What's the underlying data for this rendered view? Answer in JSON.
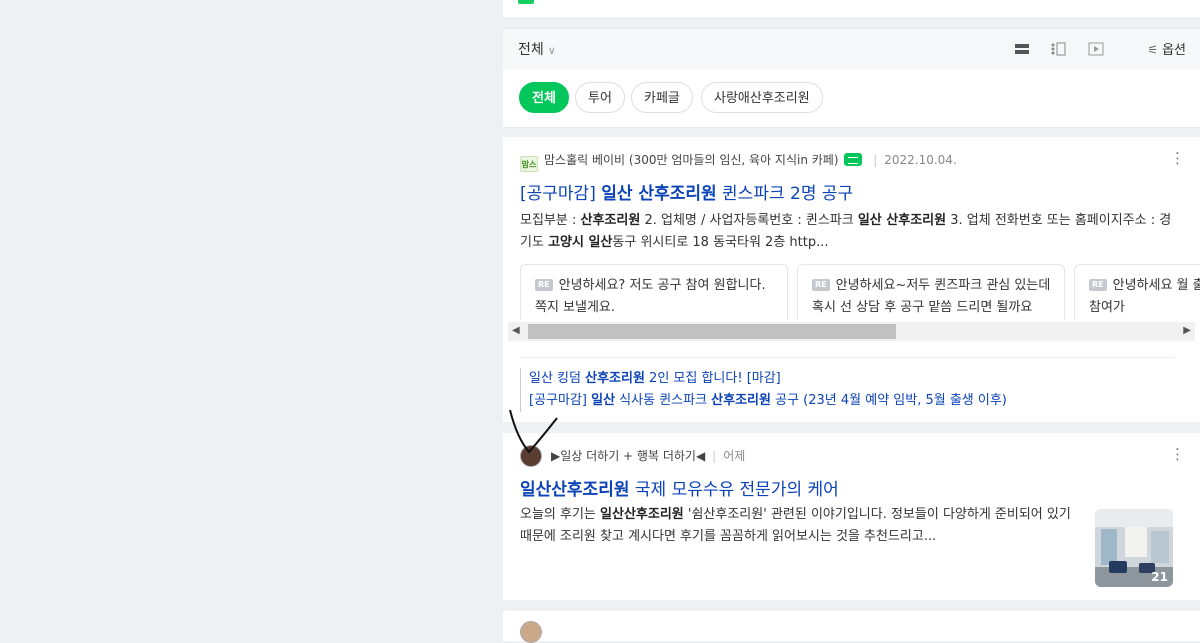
{
  "toolbar": {
    "filter_label": "전체",
    "options_label": "옵션",
    "view_icons": [
      "list-view-icon",
      "compact-view-icon",
      "video-view-icon"
    ]
  },
  "chips": [
    {
      "label": "전체",
      "active": true
    },
    {
      "label": "투어",
      "active": false
    },
    {
      "label": "카페글",
      "active": false
    },
    {
      "label": "사랑애산후조리원",
      "active": false
    }
  ],
  "results": [
    {
      "source": "맘스홀릭 베이비 (300만 엄마들의 임신, 육아 지식in 카페)",
      "logo_text": "맘스",
      "date": "2022.10.04.",
      "title_parts": [
        "[공구마감] ",
        "일산 산후조리원",
        " 퀸스파크 2명 공구"
      ],
      "desc_parts": [
        "모집부분 : ",
        "산후조리원",
        " 2. 업체명 / 사업자등록번호 : 퀸스파크 ",
        "일산 산후조리원",
        " 3. 업체 전화번호 또는 홈페이지주소 : 경기도 ",
        "고양시 일산",
        "동구 위시티로 18 동국타워 2층 http..."
      ],
      "replies": [
        "안녕하세요? 저도 공구 참여 원합니다. 쪽지 보낼게요.",
        "안녕하세요~저두 퀸즈파크 관심 있는데 혹시 선 상담 후 공구 맡씀 드리면 될까요",
        "안녕하세요 월 출산도 참여가"
      ],
      "reply_badge": "RE",
      "related": [
        {
          "parts": [
            "일산 킹덤 ",
            "산후조리원",
            " 2인 모집 합니다! [마감]"
          ]
        },
        {
          "parts": [
            "[공구마감] ",
            "일산",
            " 식사동 퀸스파크 ",
            "산후조리원",
            " 공구 (23년 4월 예약 임박, 5월 출생 이후)"
          ]
        }
      ]
    },
    {
      "source": "▶일상 더하기 + 행복 더하기◀",
      "date": "어제",
      "title_parts": [
        "일산산후조리원",
        " 국제 모유수유 전문가의 케어"
      ],
      "desc_parts": [
        "오늘의 후기는 ",
        "일산산후조리원",
        " '쉼산후조리원' 관련된 이야기입니다. 정보들이 다양하게 준비되어 있기 때문에 조리원 찾고 계시다면 후기를 꼼꼼하게 읽어보시는 것을 추천드리고..."
      ],
      "image_count": "21"
    }
  ],
  "colors": {
    "accent_green": "#03c75a",
    "link_blue": "#0c43b7",
    "background": "#eef0f3"
  }
}
